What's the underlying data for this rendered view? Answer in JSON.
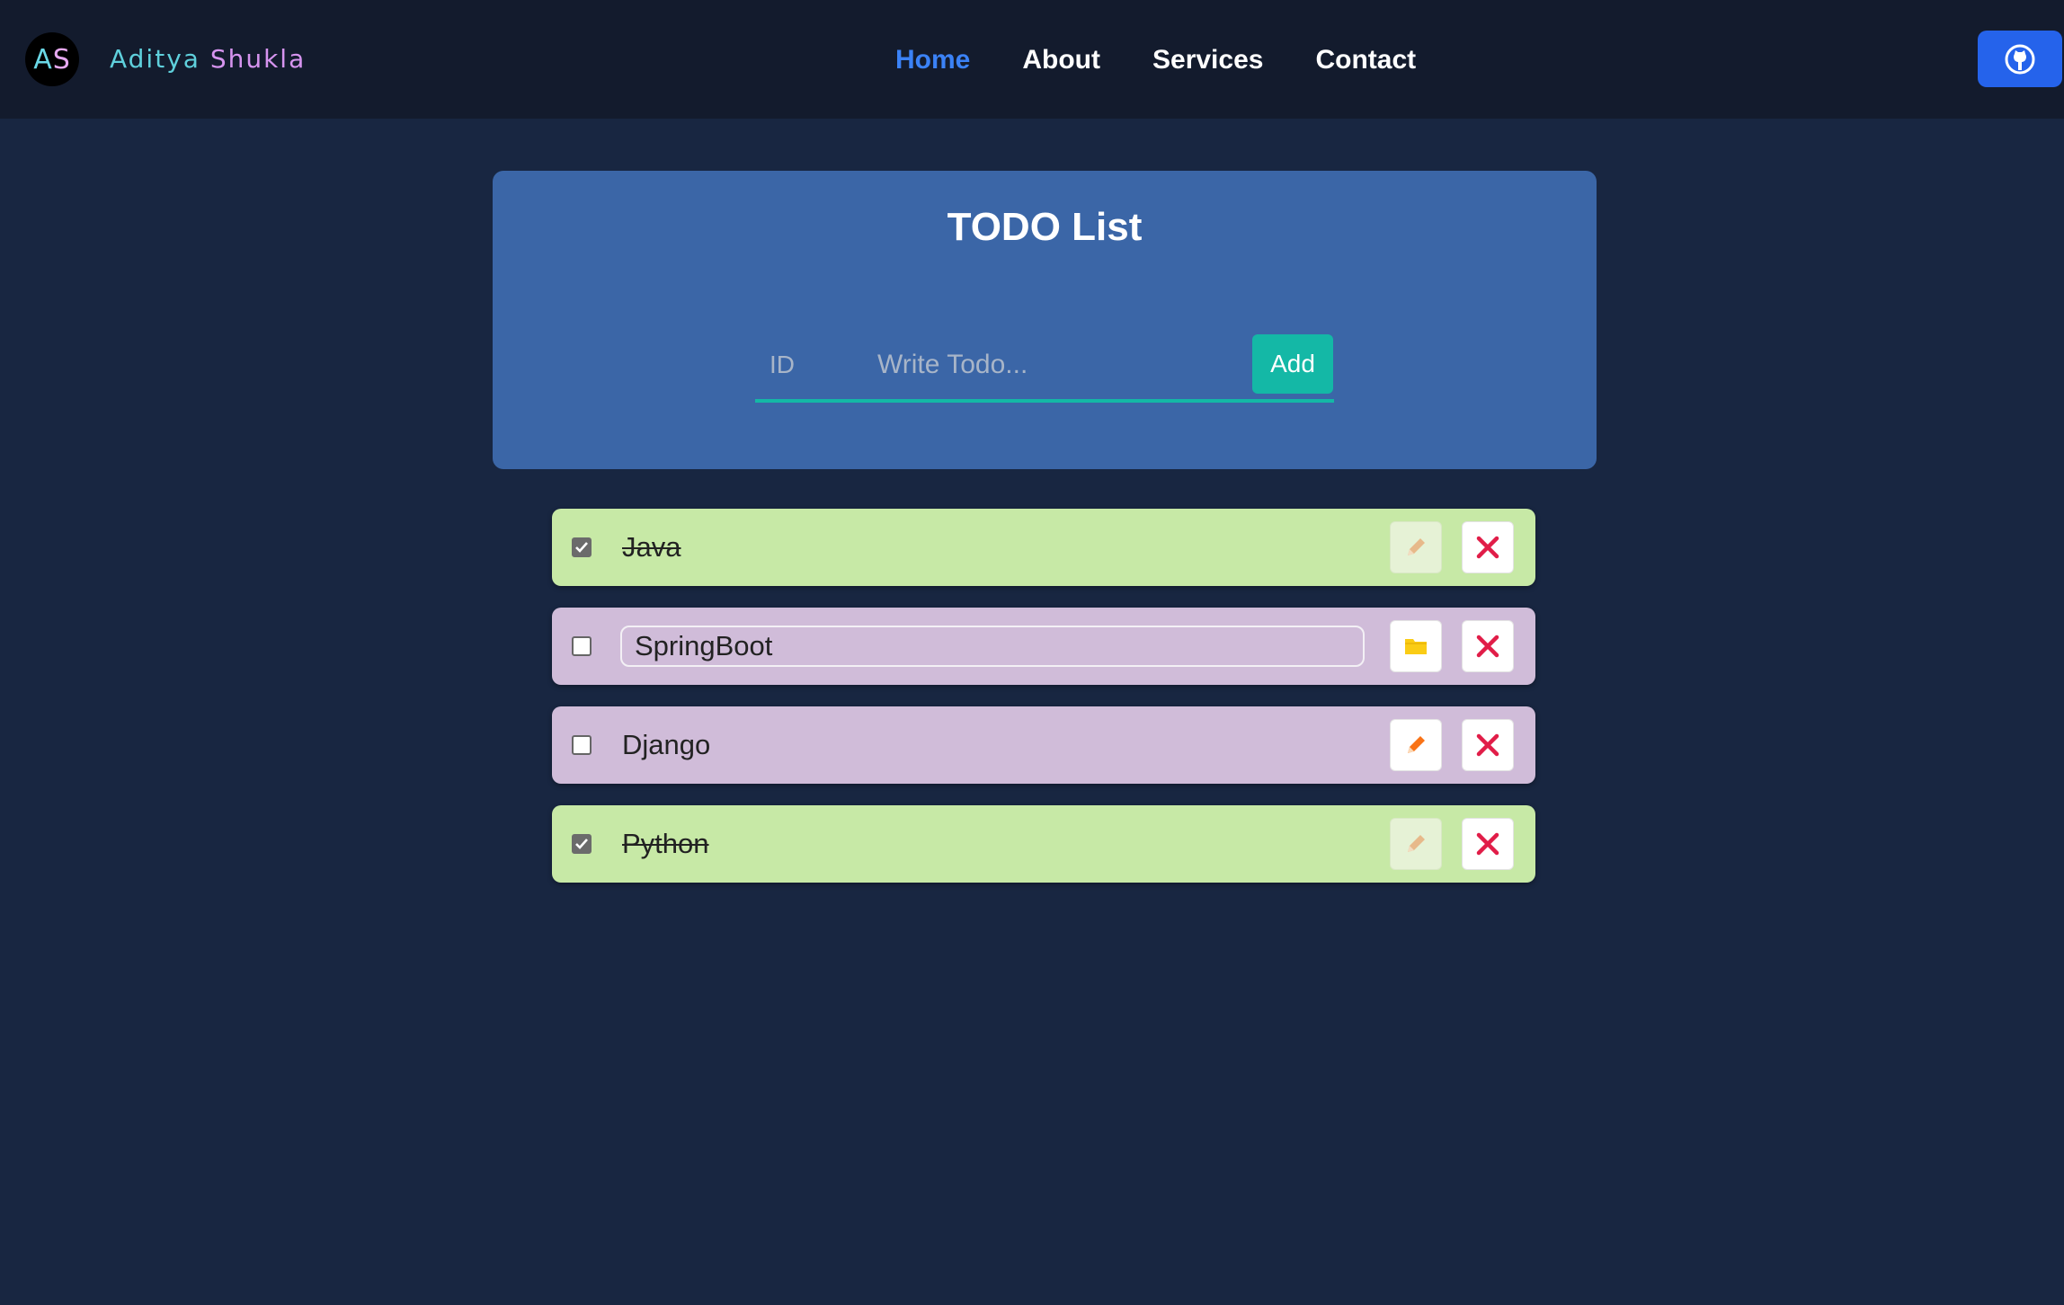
{
  "navbar": {
    "logo_initials": {
      "first": "A",
      "second": "S"
    },
    "brand": {
      "first": "Aditya",
      "last": "Shukla"
    },
    "links": [
      {
        "label": "Home",
        "active": true
      },
      {
        "label": "About",
        "active": false
      },
      {
        "label": "Services",
        "active": false
      },
      {
        "label": "Contact",
        "active": false
      }
    ],
    "github_icon": "github-icon"
  },
  "card": {
    "title": "TODO List",
    "id_placeholder": "ID",
    "todo_placeholder": "Write Todo...",
    "add_label": "Add"
  },
  "todos": [
    {
      "text": "Java",
      "completed": true,
      "editing": false
    },
    {
      "text": "SpringBoot",
      "completed": false,
      "editing": true
    },
    {
      "text": "Django",
      "completed": false,
      "editing": false
    },
    {
      "text": "Python",
      "completed": true,
      "editing": false
    }
  ],
  "icons": {
    "edit": "pencil-icon",
    "save": "folder-icon",
    "delete": "close-icon"
  },
  "colors": {
    "background": "#182641",
    "navbar": "#131b2d",
    "active_link": "#3b82f6",
    "card": "#3b66a7",
    "accent": "#14b8a6",
    "completed_item": "#c7e9a6",
    "pending_item": "#d0bcd9",
    "delete": "#e11d48",
    "edit": "#f97316",
    "save": "#facc15"
  }
}
